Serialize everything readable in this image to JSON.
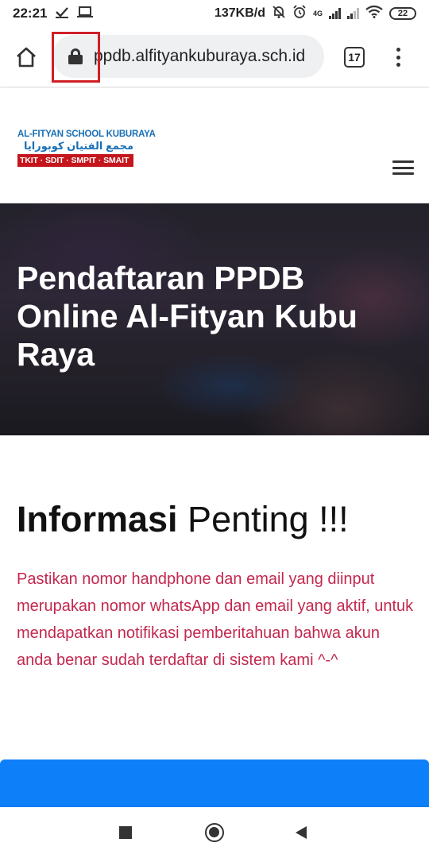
{
  "status_bar": {
    "time": "22:21",
    "network_speed": "137KB/d",
    "network_type": "4G",
    "battery": "22"
  },
  "browser": {
    "url": "ppdb.alfityankuburaya.sch.id",
    "tab_count": "17"
  },
  "site": {
    "logo": {
      "line1": "AL-FITYAN SCHOOL KUBURAYA",
      "line2": "مجمع الفتيان كوبورايا",
      "line3": "TKIT · SDIT · SMPIT · SMAIT"
    }
  },
  "hero": {
    "title": "Pendaftaran PPDB Online Al-Fityan Kubu Raya"
  },
  "info": {
    "title_bold": "Informasi",
    "title_rest": " Penting !!!",
    "text": "Pastikan nomor handphone dan email yang diinput merupakan nomor whatsApp dan email yang aktif, untuk mendapatkan notifikasi pemberitahuan bahwa akun anda benar sudah terdaftar di sistem kami ^-^"
  },
  "colors": {
    "accent_blue": "#0d7ff9",
    "info_text": "#c3284e",
    "logo_blue": "#1a6fb5",
    "logo_red": "#c4161c",
    "highlight": "#d01f26"
  }
}
